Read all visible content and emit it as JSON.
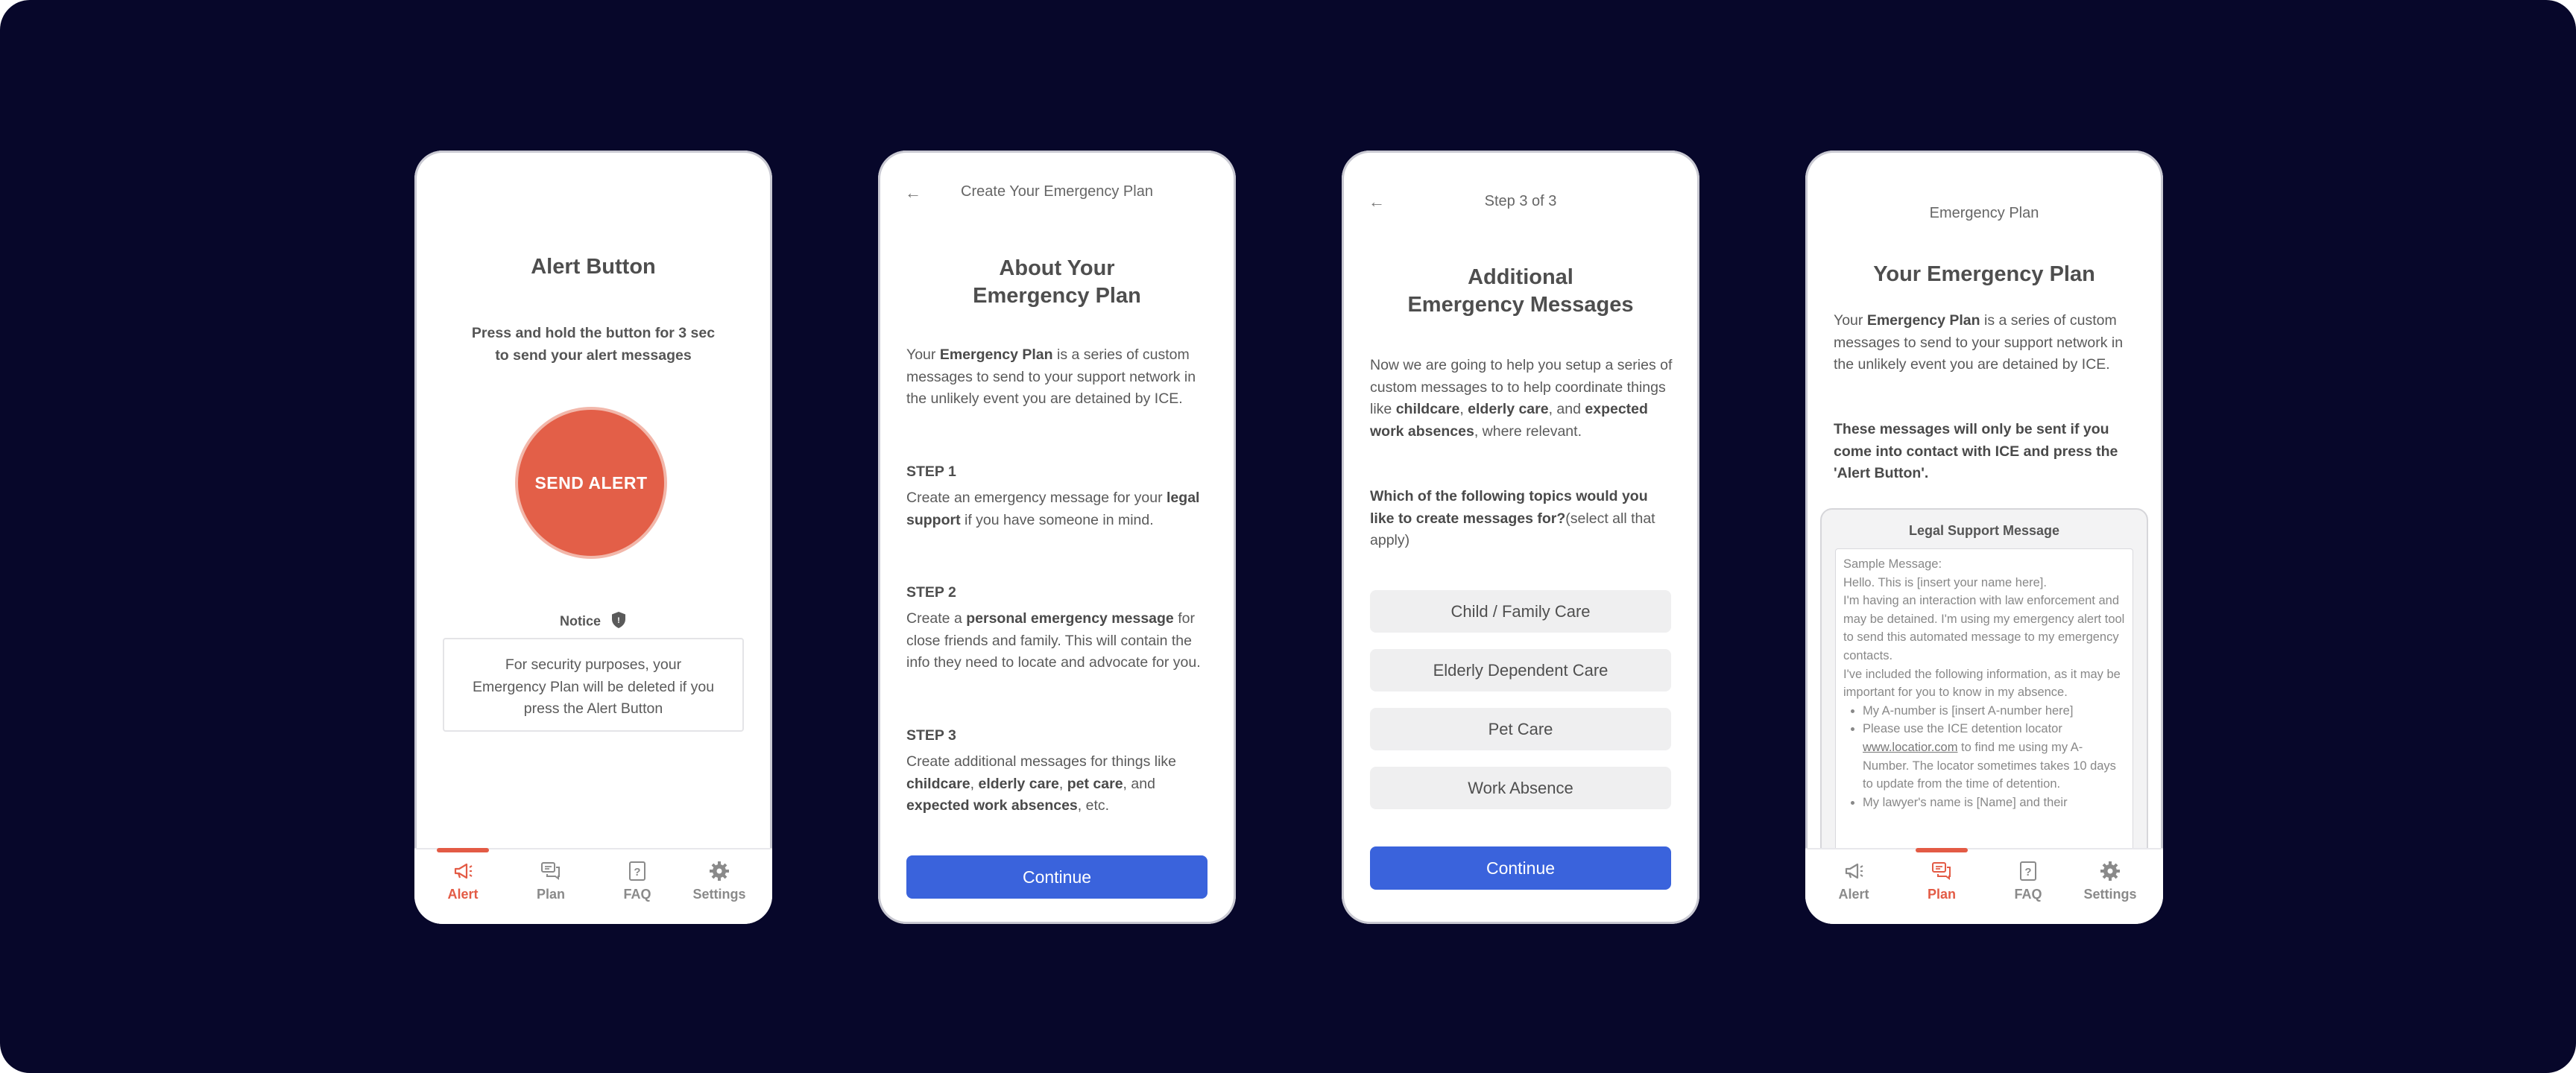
{
  "colors": {
    "background": "#07072a",
    "accent": "#e35b45",
    "primary": "#3a63dc"
  },
  "nav": {
    "alert": "Alert",
    "plan": "Plan",
    "faq": "FAQ",
    "settings": "Settings"
  },
  "screen1": {
    "title": "Alert Button",
    "instruction_line1": "Press and hold the button for 3 sec",
    "instruction_line2": "to send your alert messages",
    "send_alert": "SEND ALERT",
    "notice_label": "Notice",
    "notice_text": "For security purposes, your Emergency Plan will be deleted if you press the Alert Button"
  },
  "screen2": {
    "header": "Create Your Emergency Plan",
    "title_line1": "About Your",
    "title_line2": "Emergency Plan",
    "intro_pre": "Your ",
    "intro_bold": "Emergency Plan",
    "intro_post": " is a series of custom messages to send to your support network in the unlikely event you are detained by ICE.",
    "step1_heading": "STEP 1",
    "step1_pre": "Create an emergency message for your ",
    "step1_bold": "legal support",
    "step1_post": " if you have someone in mind.",
    "step2_heading": "STEP 2",
    "step2_pre": "Create a ",
    "step2_bold": "personal emergency message",
    "step2_post": " for close friends and family. This will contain the info they need to locate and advocate for you.",
    "step3_heading": "STEP 3",
    "step3_pre": "Create additional messages for things like ",
    "step3_b1": "childcare",
    "step3_s1": ", ",
    "step3_b2": "elderly care",
    "step3_s2": ", ",
    "step3_b3": "pet care",
    "step3_s3": ", and ",
    "step3_b4": "expected work absences",
    "step3_post": ", etc.",
    "continue": "Continue"
  },
  "screen3": {
    "header": "Step 3 of 3",
    "title_line1": "Additional",
    "title_line2": "Emergency Messages",
    "intro_pre": "Now we are going to help you setup a series of custom messages to to help coordinate things like ",
    "intro_b1": "childcare",
    "intro_s1": ", ",
    "intro_b2": "elderly care",
    "intro_s2": ", and ",
    "intro_b3": "expected work absences",
    "intro_post": ", where relevant.",
    "question_bold": "Which of the following topics would you like to create messages for?",
    "question_post": "(select all that apply)",
    "options": [
      "Child / Family Care",
      "Elderly Dependent Care",
      "Pet Care",
      "Work Absence"
    ],
    "continue": "Continue"
  },
  "screen4": {
    "header": "Emergency Plan",
    "title": "Your Emergency Plan",
    "intro_pre": "Your ",
    "intro_bold": "Emergency Plan",
    "intro_post": " is a series of custom messages to send to your support network in the unlikely event you are detained by ICE.",
    "warning": "These messages will only be sent if you come into contact with ICE and press the 'Alert Button'.",
    "legal_title": "Legal Support Message",
    "sample_label": "Sample Message:",
    "sample_line1": "Hello. This is [insert your name here].",
    "sample_line2": "I'm having an interaction with law enforcement and may be detained. I'm using my emergency alert tool to send this automated message to my emergency contacts.",
    "sample_line3": "I've included the following information, as it may be important for you to know in my absence.",
    "bullet1": "My A-number is [insert A-number here]",
    "bullet2_pre": "Please use the ICE detention locator ",
    "bullet2_link": "www.locatior.com",
    "bullet2_post": " to find me using my A-Number. The locator sometimes takes 10 days to update from the time of detention.",
    "bullet3": "My lawyer's name is [Name] and their"
  }
}
